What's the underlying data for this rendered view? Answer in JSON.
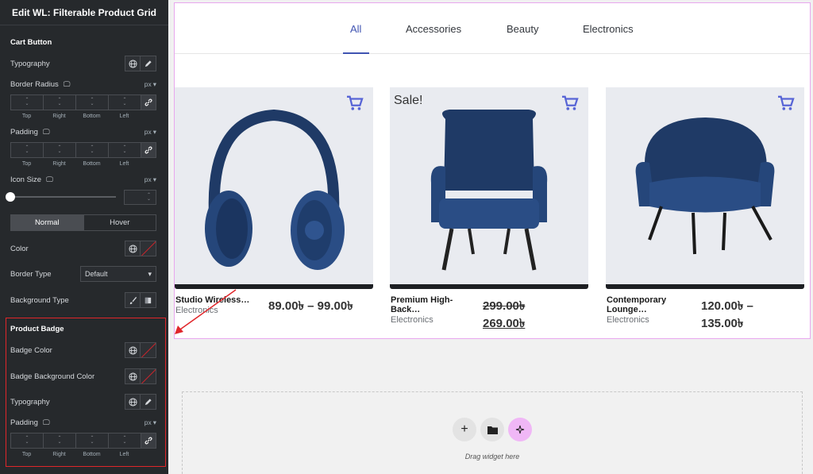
{
  "panel": {
    "title": "Edit WL: Filterable Product Grid",
    "cart_section": "Cart Button",
    "typography": "Typography",
    "border_radius": "Border Radius",
    "padding": "Padding",
    "icon_size": "Icon Size",
    "unit": "px",
    "dim_labels": [
      "Top",
      "Right",
      "Bottom",
      "Left"
    ],
    "tab_normal": "Normal",
    "tab_hover": "Hover",
    "color": "Color",
    "border_type": "Border Type",
    "border_type_value": "Default",
    "background_type": "Background Type",
    "badge_section": "Product Badge",
    "badge_color": "Badge Color",
    "badge_bg_color": "Badge Background Color",
    "badge_typography": "Typography",
    "badge_padding": "Padding"
  },
  "filters": [
    "All",
    "Accessories",
    "Beauty",
    "Electronics"
  ],
  "products": [
    {
      "name": "Studio Wireless…",
      "category": "Electronics",
      "price": "89.00৳ – 99.00৳",
      "sale": ""
    },
    {
      "name": "Premium High-Back…",
      "category": "Electronics",
      "price_old": "299.00৳",
      "price_new": "269.00৳",
      "sale": "Sale!"
    },
    {
      "name": "Contemporary Lounge…",
      "category": "Electronics",
      "price_line1": "120.00৳ –",
      "price_line2": "135.00৳",
      "sale": ""
    }
  ],
  "dropzone": {
    "text": "Drag widget here",
    "add": "+"
  },
  "colors": {
    "accent": "#4054b2",
    "cart": "#5865d6",
    "badge_border": "#e0262a"
  }
}
